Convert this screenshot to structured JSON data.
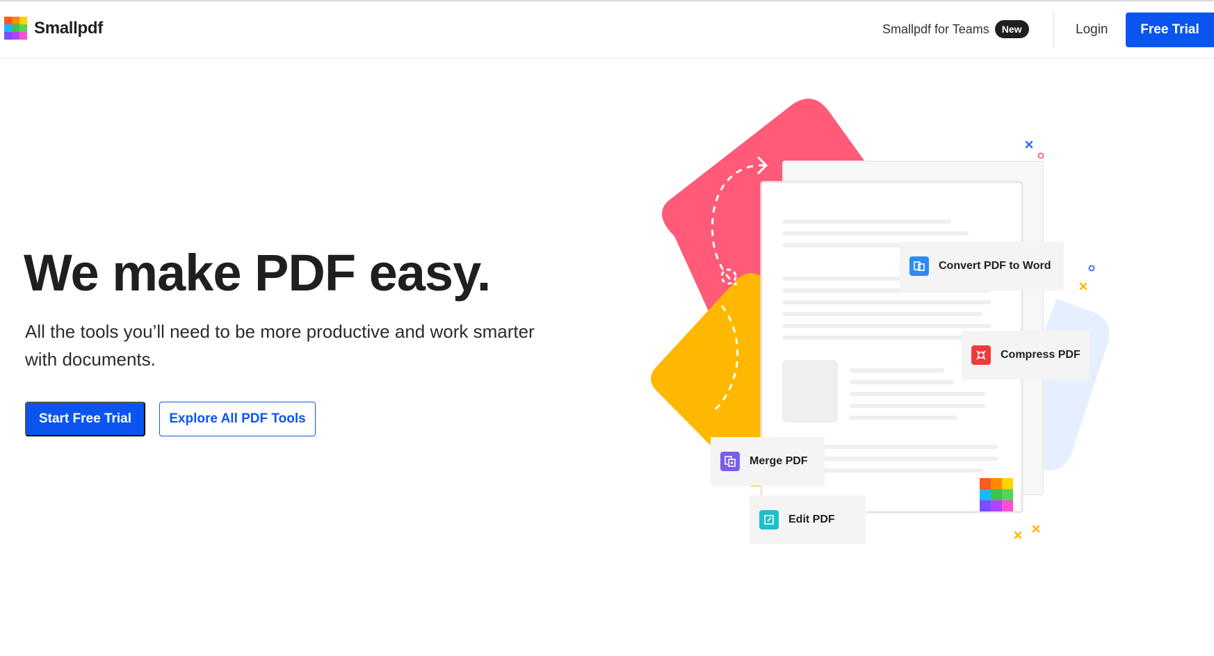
{
  "header": {
    "brand": "Smallpdf",
    "logo_colors": [
      "#ff5a1f",
      "#ff8a00",
      "#ffd400",
      "#1fb4ff",
      "#3dc44c",
      "#55d35a",
      "#7a4dff",
      "#b144ff",
      "#ff4fd2"
    ],
    "teams_label": "Smallpdf for Teams",
    "teams_badge": "New",
    "login_label": "Login",
    "free_trial_label": "Free Trial"
  },
  "hero": {
    "title": "We make PDF easy.",
    "subtitle": "All the tools you’ll need to be more productive and work smarter with documents.",
    "start_label": "Start Free Trial",
    "explore_label": "Explore All PDF Tools"
  },
  "tools": [
    {
      "label": "Convert PDF to Word",
      "icon": "convert-icon",
      "color": "#2f8af5"
    },
    {
      "label": "Compress PDF",
      "icon": "compress-icon",
      "color": "#f03a3a"
    },
    {
      "label": "Merge PDF",
      "icon": "merge-icon",
      "color": "#7a5cf0"
    },
    {
      "label": "Edit PDF",
      "icon": "edit-icon",
      "color": "#1ec0c8"
    }
  ],
  "colors": {
    "accent": "#0a55f0",
    "pink_shape": "#ff5a78",
    "yellow_shape": "#ffb800",
    "blue_shape": "#e6efff"
  }
}
